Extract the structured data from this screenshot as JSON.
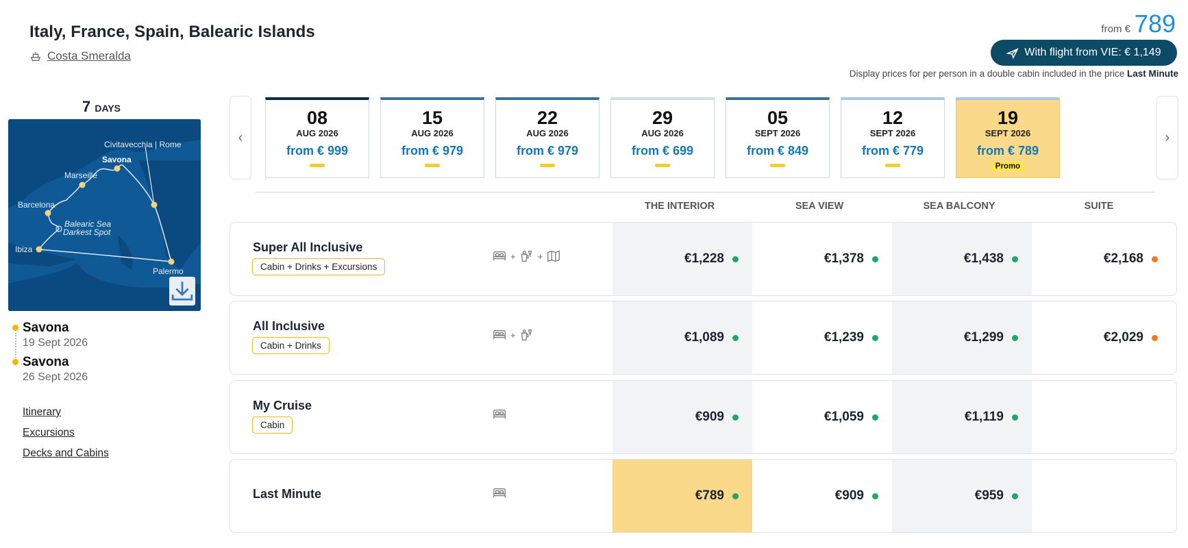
{
  "header": {
    "title": "Italy, France, Spain, Balearic Islands",
    "ship": "Costa Smeralda",
    "from_label": "from €",
    "from_price": "789",
    "flight_button": "With flight from VIE: € 1,149",
    "note_prefix": "Display prices for per person in a double cabin included in the price",
    "note_bold": "Last Minute"
  },
  "cruise": {
    "days_number": "7",
    "days_label": "DAYS",
    "map_labels": {
      "civitavecchia": "Civitavecchia | Rome",
      "savona": "Savona",
      "marseille": "Marseille",
      "barcelona": "Barcelona",
      "balearic_1": "Balearic Sea",
      "balearic_2": "Darkest Spot",
      "ibiza": "Ibiza",
      "palermo": "Palermo"
    },
    "departure": {
      "port": "Savona",
      "date": "19 Sept 2026"
    },
    "arrival": {
      "port": "Savona",
      "date": "26 Sept 2026"
    },
    "links": [
      "Itinerary",
      "Excursions",
      "Decks and Cabins"
    ]
  },
  "dates": [
    {
      "day": "08",
      "month": "AUG 2026",
      "price": "from € 999",
      "top": "#0c2d44"
    },
    {
      "day": "15",
      "month": "AUG 2026",
      "price": "from € 979",
      "top": "#3d6ea0"
    },
    {
      "day": "22",
      "month": "AUG 2026",
      "price": "from € 979",
      "top": "#3d6ea0"
    },
    {
      "day": "29",
      "month": "AUG 2026",
      "price": "from € 699",
      "top": "#cde0f0"
    },
    {
      "day": "05",
      "month": "SEPT 2026",
      "price": "from € 849",
      "top": "#3d6ea0"
    },
    {
      "day": "12",
      "month": "SEPT 2026",
      "price": "from € 779",
      "top": "#a9c8e6"
    },
    {
      "day": "19",
      "month": "SEPT 2026",
      "price": "from € 789",
      "promo": "Promo",
      "top": "#a9c8e6"
    }
  ],
  "columns": [
    "THE INTERIOR",
    "SEA VIEW",
    "SEA BALCONY",
    "SUITE"
  ],
  "packages": [
    {
      "name": "Super All Inclusive",
      "tag": "Cabin + Drinks + Excursions",
      "icons": "bed-drinks-map",
      "prices": [
        "€1,228",
        "€1,378",
        "€1,438",
        "€2,168"
      ],
      "status": [
        "#1ea866",
        "#1ea866",
        "#1ea866",
        "#f07a22"
      ]
    },
    {
      "name": "All Inclusive",
      "tag": "Cabin + Drinks",
      "icons": "bed-drinks",
      "prices": [
        "€1,089",
        "€1,239",
        "€1,299",
        "€2,029"
      ],
      "status": [
        "#1ea866",
        "#1ea866",
        "#1ea866",
        "#f07a22"
      ]
    },
    {
      "name": "My Cruise",
      "tag": "Cabin",
      "icons": "bed",
      "prices": [
        "€909",
        "€1,059",
        "€1,119"
      ],
      "status": [
        "#1ea866",
        "#1ea866",
        "#1ea866"
      ]
    },
    {
      "name": "Last Minute",
      "tag": "",
      "icons": "bed",
      "prices": [
        "€789",
        "€909",
        "€959"
      ],
      "status": [
        "#1ea866",
        "#1ea866",
        "#1ea866"
      ],
      "highlight_first": true
    }
  ],
  "colors": {
    "accent_blue": "#1e8fd8",
    "button_dark": "#0c4a66",
    "promo_yellow": "#fbd98a",
    "tag_border": "#f2b418",
    "available_green": "#1ea866",
    "limited_orange": "#f07a22"
  }
}
